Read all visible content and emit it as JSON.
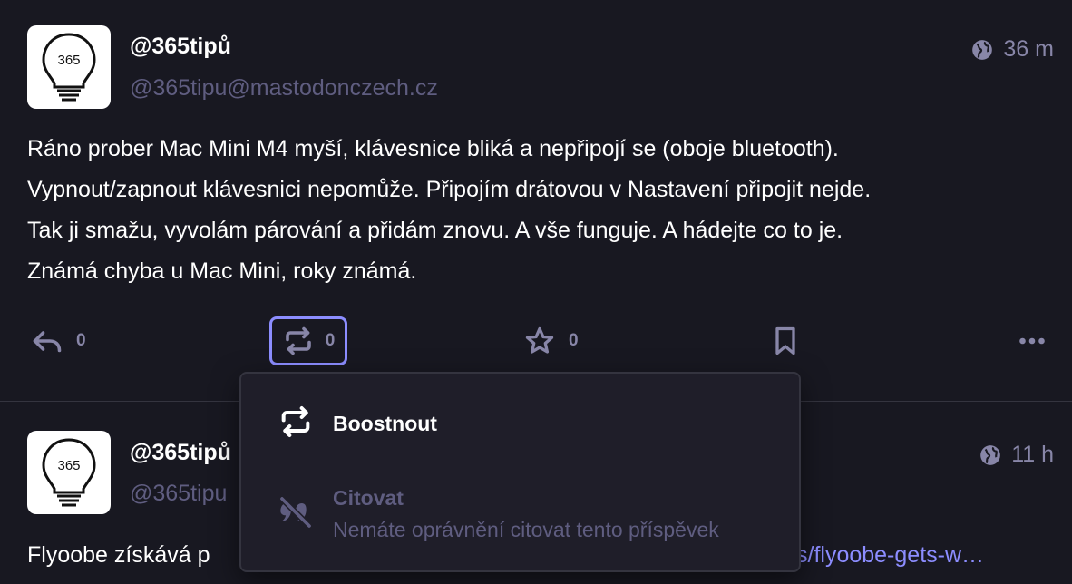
{
  "colors": {
    "background": "#181821",
    "accent": "#8c8dff",
    "muted": "#8886a8",
    "handle": "#5f5d80",
    "menu_bg": "#1f1e29"
  },
  "posts": [
    {
      "display_name": "@365tipů",
      "handle": "@365tipu@mastodonczech.cz",
      "avatar_text": "365",
      "visibility_icon": "globe-icon",
      "time": "36 m",
      "content_lines": [
        "Ráno prober Mac Mini M4 myší, klávesnice bliká a nepřipojí se (oboje bluetooth).",
        "Vypnout/zapnout klávesnici nepomůže. Připojím drátovou v Nastavení připojit nejde.",
        "Tak ji smažu, vyvolám párování a přidám znovu. A vše funguje. A hádejte co to je.",
        "Známá chyba u Mac Mini, roky známá."
      ],
      "actions": {
        "reply_count": "0",
        "boost_count": "0",
        "favourite_count": "0"
      }
    },
    {
      "display_name": "@365tipů",
      "handle": "@365tipu",
      "avatar_text": "365",
      "visibility_icon": "globe-icon",
      "time": "11 h",
      "content_start": "Flyoobe získává p",
      "content_link_tail": "s/flyoobe-gets-w…"
    }
  ],
  "boost_menu": {
    "boost": {
      "icon": "boost-icon",
      "label": "Boostnout"
    },
    "quote": {
      "icon": "quote-disabled-icon",
      "label": "Citovat",
      "description": "Nemáte oprávnění citovat tento příspěvek"
    }
  }
}
